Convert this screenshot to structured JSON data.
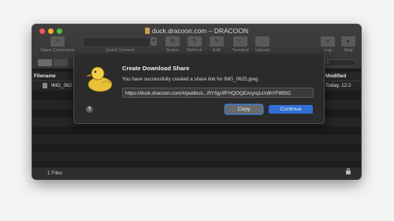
{
  "window": {
    "title": "duck.dracoon.com – DRACOON"
  },
  "toolbar": {
    "open_connection": "Open Connection",
    "quick_connect": "Quick Connect",
    "action": "Action",
    "refresh": "Refresh",
    "edit": "Edit",
    "terminal": "Terminal",
    "upload": "Upload",
    "log": "Log",
    "stop": "Stop"
  },
  "search": {
    "placeholder": "rch"
  },
  "columns": {
    "filename": "Filename",
    "modified": "Modified"
  },
  "files": [
    {
      "name": "IMG_062",
      "modified": "Today, 12:2"
    }
  ],
  "status": {
    "count": "1 Files"
  },
  "dialog": {
    "title": "Create Download Share",
    "message": "You have successfully created a share link for IMG_0625.jpeg.",
    "link": "https://duck.dracoon.com/#/public/s...RYSjy3fFHQOQEAryrq1xVdhYF89SC",
    "help": "?",
    "copy": "Copy",
    "continue": "Continue"
  },
  "colors": {
    "accent": "#2f6fd6",
    "close": "#ee5a52",
    "minimize": "#e6b02d",
    "maximize": "#4cbf3e"
  }
}
